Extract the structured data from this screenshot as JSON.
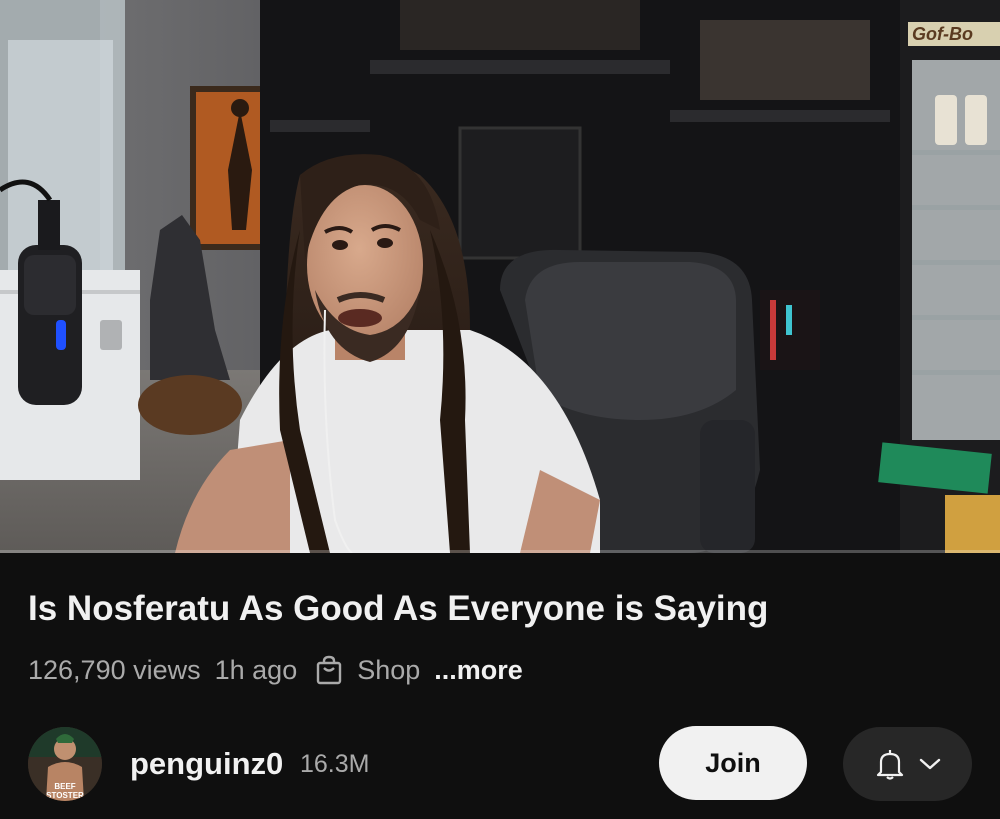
{
  "video": {
    "title": "Is Nosferatu As Good As Everyone is Saying",
    "progress_fraction": 0.0,
    "sign_text": "Gof-Bo"
  },
  "meta": {
    "views": "126,790 views",
    "age": "1h ago",
    "shop_label": "Shop",
    "more_label": "...more"
  },
  "channel": {
    "name": "penguinz0",
    "subscribers": "16.3M",
    "avatar_text_line1": "BEEF",
    "avatar_text_line2": "STOSTER"
  },
  "actions": {
    "join_label": "Join"
  },
  "icons": {
    "shop": "shopping-bag-icon",
    "notify": "bell-icon",
    "dropdown": "chevron-down-icon"
  },
  "colors": {
    "background": "#0f0f0f",
    "primary_text": "#f1f1f1",
    "secondary_text": "#aaaaaa",
    "join_bg": "#f1f1f1",
    "notify_bg": "#272727",
    "progress": "#ff0000"
  }
}
